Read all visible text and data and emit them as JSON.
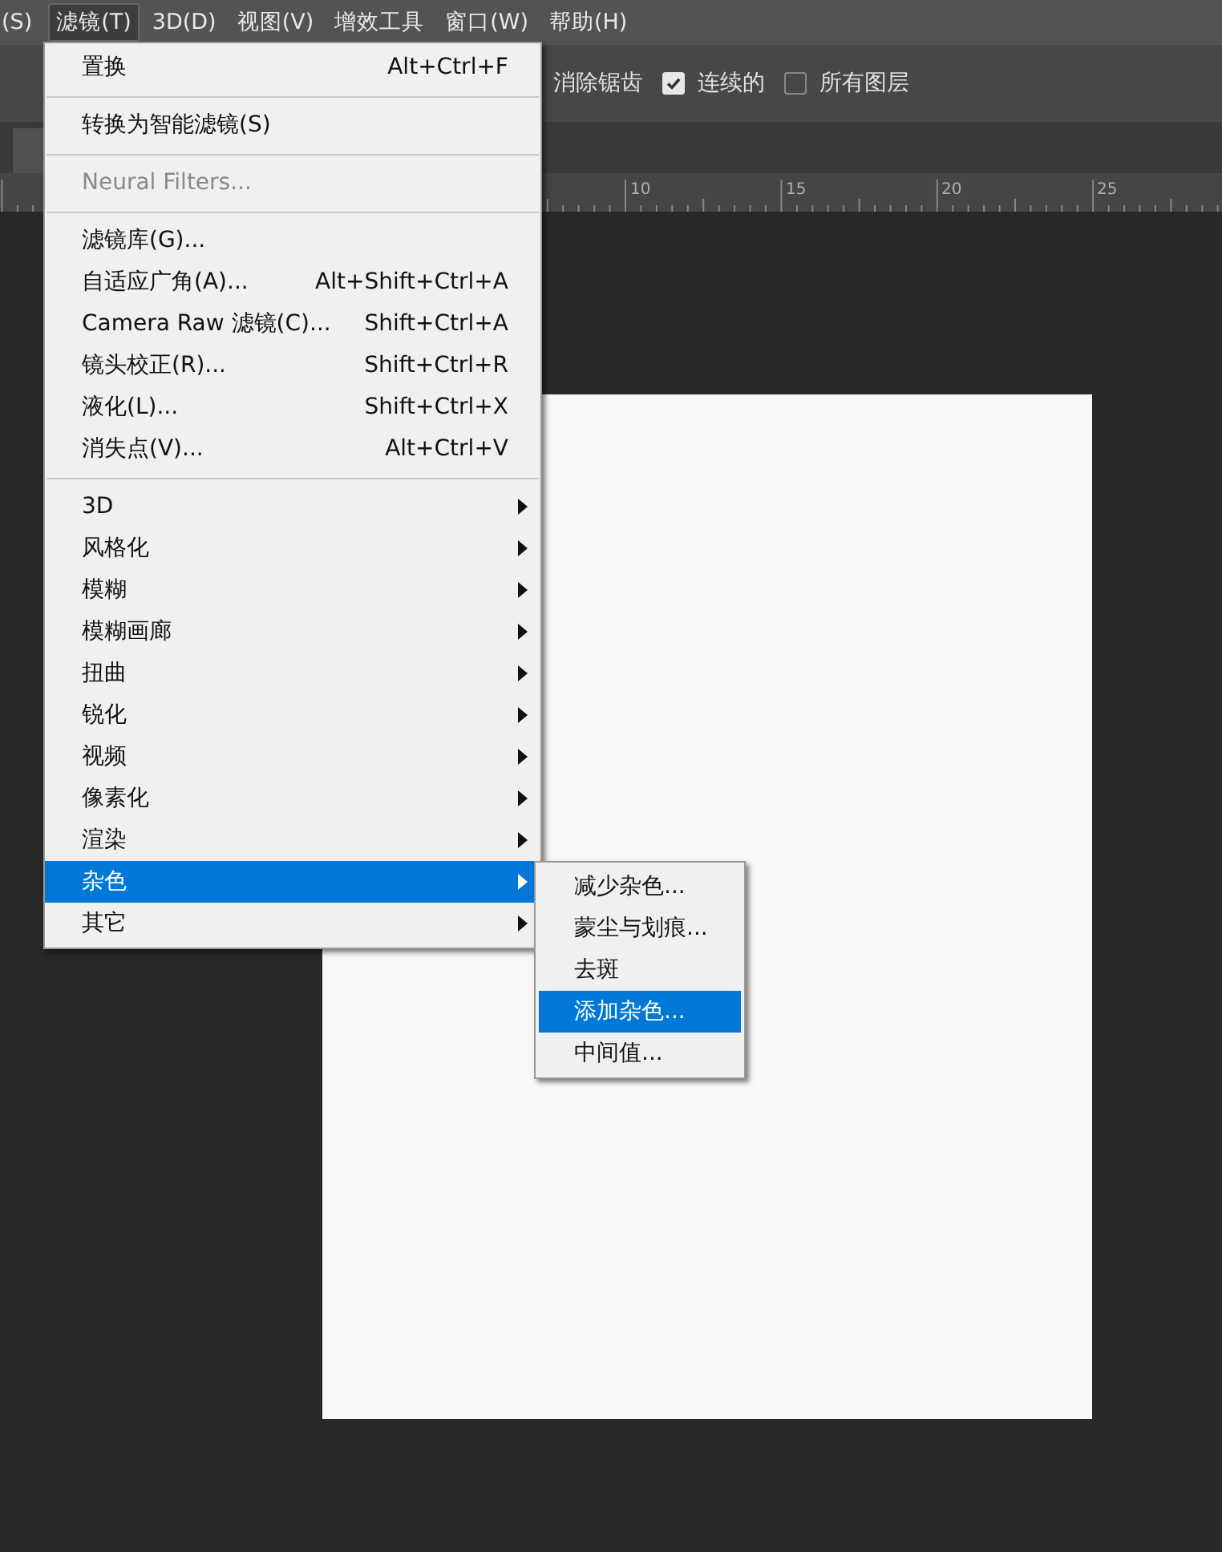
{
  "menu_bar": [
    {
      "label": "(S)",
      "selected": false
    },
    {
      "label": "滤镜(T)",
      "selected": true
    },
    {
      "label": "3D(D)",
      "selected": false
    },
    {
      "label": "视图(V)",
      "selected": false
    },
    {
      "label": "增效工具",
      "selected": false
    },
    {
      "label": "窗口(W)",
      "selected": false
    },
    {
      "label": "帮助(H)",
      "selected": false
    }
  ],
  "options_bar": {
    "label": "消除锯齿",
    "toggles": [
      {
        "label": "连续的",
        "checked": true
      },
      {
        "label": "所有图层",
        "checked": false
      }
    ]
  },
  "ruler": {
    "labels": [
      "10",
      "15",
      "20",
      "25"
    ]
  },
  "filter_menu": {
    "sections": [
      [
        {
          "label": "置换",
          "shortcut": "Alt+Ctrl+F",
          "disabled": false,
          "submenu": false,
          "selected": false
        }
      ],
      [
        {
          "label": "转换为智能滤镜(S)",
          "disabled": false,
          "submenu": false,
          "selected": false
        }
      ],
      [
        {
          "label": "Neural Filters...",
          "disabled": true,
          "submenu": false,
          "selected": false
        }
      ],
      [
        {
          "label": "滤镜库(G)...",
          "disabled": false,
          "submenu": false,
          "selected": false
        },
        {
          "label": "自适应广角(A)...",
          "shortcut": "Alt+Shift+Ctrl+A",
          "disabled": false,
          "submenu": false,
          "selected": false
        },
        {
          "label": "Camera Raw 滤镜(C)...",
          "shortcut": "Shift+Ctrl+A",
          "disabled": false,
          "submenu": false,
          "selected": false
        },
        {
          "label": "镜头校正(R)...",
          "shortcut": "Shift+Ctrl+R",
          "disabled": false,
          "submenu": false,
          "selected": false
        },
        {
          "label": "液化(L)...",
          "shortcut": "Shift+Ctrl+X",
          "disabled": false,
          "submenu": false,
          "selected": false
        },
        {
          "label": "消失点(V)...",
          "shortcut": "Alt+Ctrl+V",
          "disabled": false,
          "submenu": false,
          "selected": false
        }
      ],
      [
        {
          "label": "3D",
          "disabled": false,
          "submenu": true,
          "selected": false
        },
        {
          "label": "风格化",
          "disabled": false,
          "submenu": true,
          "selected": false
        },
        {
          "label": "模糊",
          "disabled": false,
          "submenu": true,
          "selected": false
        },
        {
          "label": "模糊画廊",
          "disabled": false,
          "submenu": true,
          "selected": false
        },
        {
          "label": "扭曲",
          "disabled": false,
          "submenu": true,
          "selected": false
        },
        {
          "label": "锐化",
          "disabled": false,
          "submenu": true,
          "selected": false
        },
        {
          "label": "视频",
          "disabled": false,
          "submenu": true,
          "selected": false
        },
        {
          "label": "像素化",
          "disabled": false,
          "submenu": true,
          "selected": false
        },
        {
          "label": "渲染",
          "disabled": false,
          "submenu": true,
          "selected": false
        },
        {
          "label": "杂色",
          "disabled": false,
          "submenu": true,
          "selected": true
        },
        {
          "label": "其它",
          "disabled": false,
          "submenu": true,
          "selected": false
        }
      ]
    ]
  },
  "noise_submenu": [
    {
      "label": "减少杂色...",
      "selected": false
    },
    {
      "label": "蒙尘与划痕...",
      "selected": false
    },
    {
      "label": "去斑",
      "selected": false
    },
    {
      "label": "添加杂色...",
      "selected": true
    },
    {
      "label": "中间值...",
      "selected": false
    }
  ]
}
